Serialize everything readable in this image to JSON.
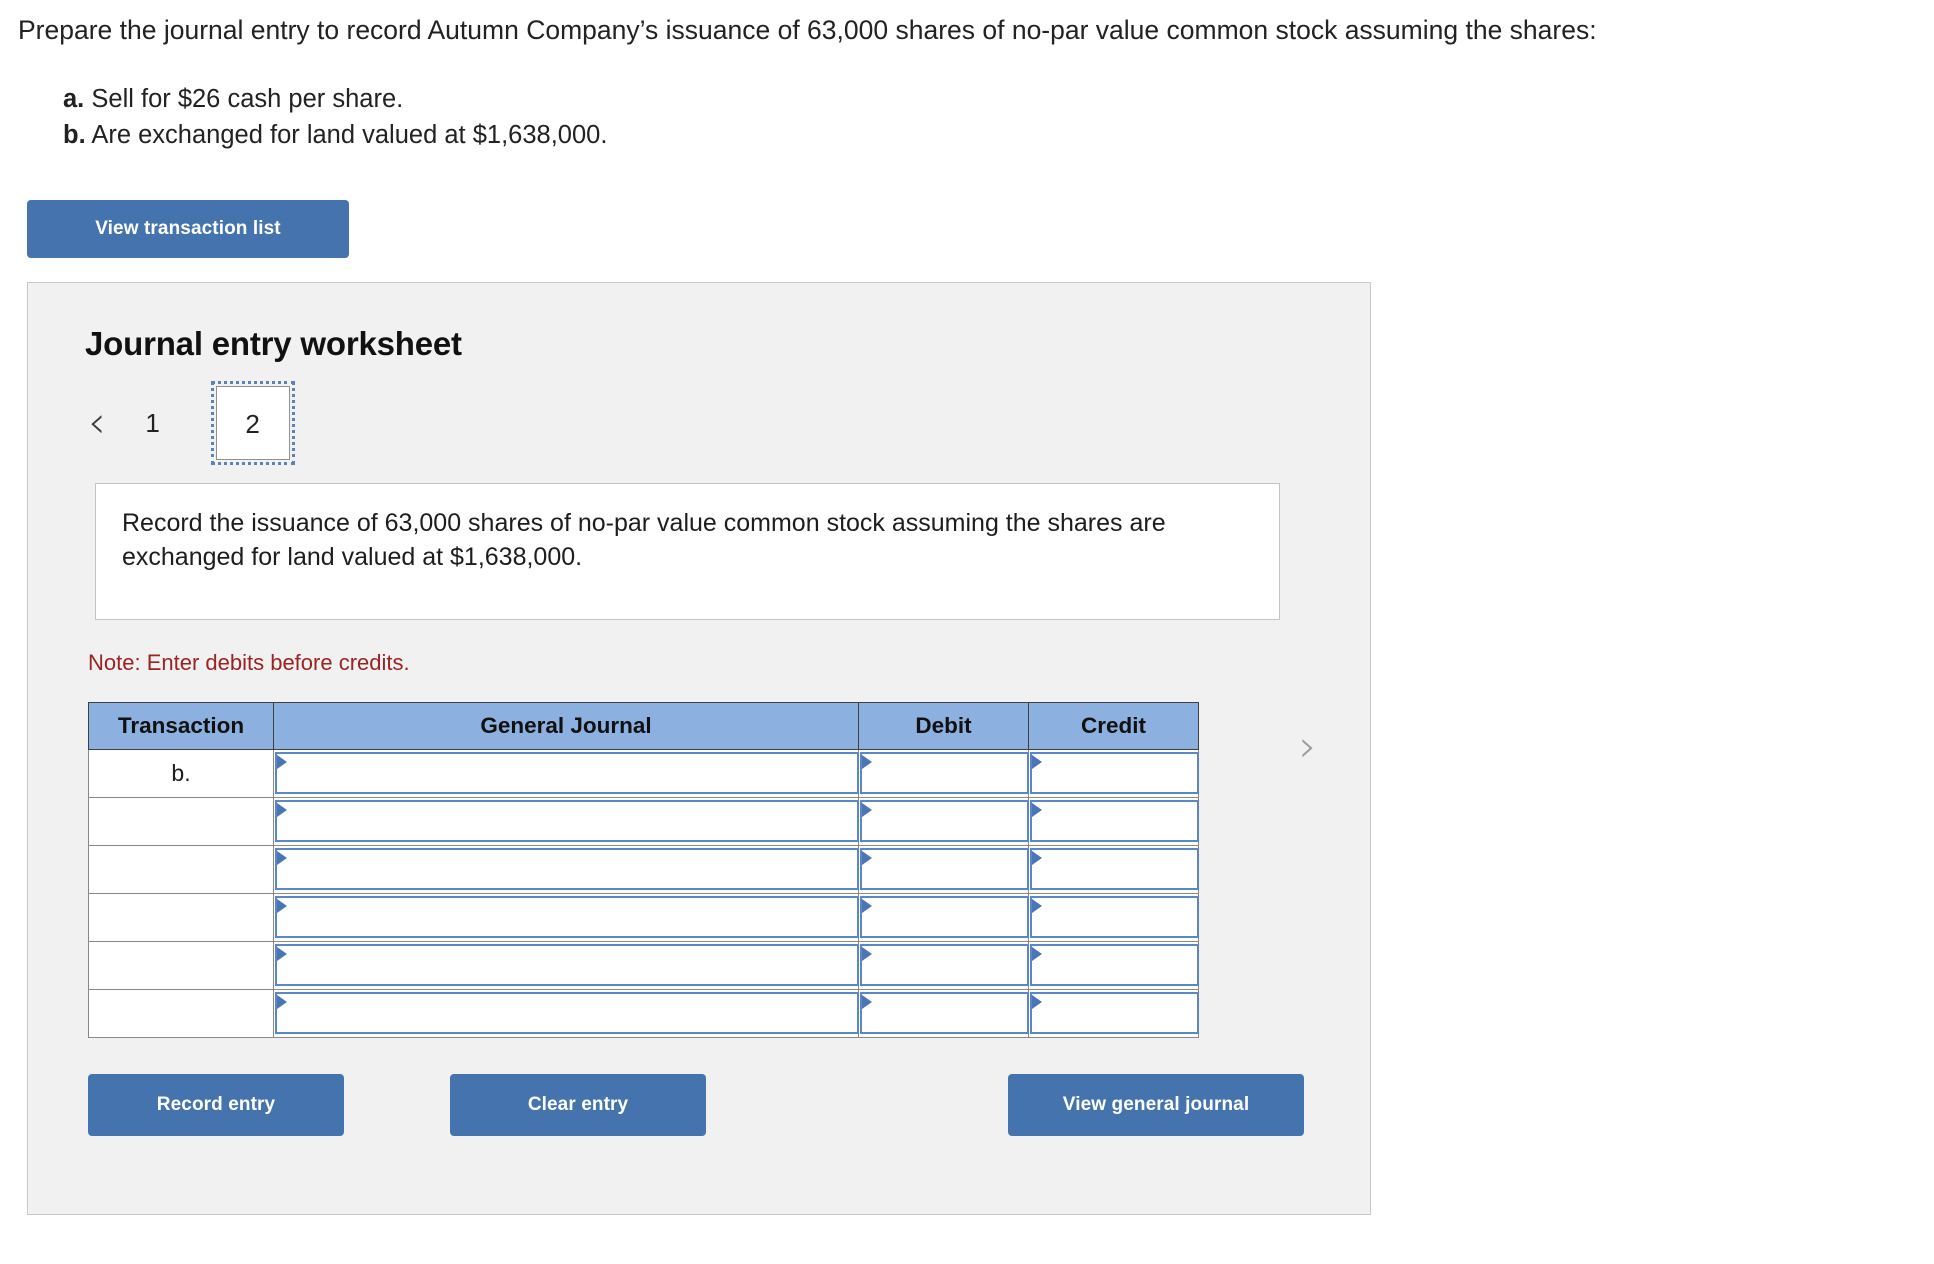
{
  "question": {
    "prompt": "Prepare the journal entry to record Autumn Company’s issuance of 63,000 shares of no-par value common stock assuming the shares:",
    "items": [
      {
        "label": "a.",
        "text": "Sell for $26 cash per share."
      },
      {
        "label": "b.",
        "text": "Are exchanged for land valued at $1,638,000."
      }
    ]
  },
  "toolbar": {
    "view_transaction_list_label": "View transaction list"
  },
  "worksheet": {
    "title": "Journal entry worksheet",
    "pager": {
      "prev_icon": "‹",
      "next_icon": "›",
      "pages": [
        "1",
        "2"
      ],
      "active_page": "2"
    },
    "instruction": "Record the issuance of 63,000 shares of no-par value common stock assuming the shares are exchanged for land valued at $1,638,000.",
    "note": "Note: Enter debits before credits.",
    "table": {
      "headers": [
        "Transaction",
        "General Journal",
        "Debit",
        "Credit"
      ],
      "rows": [
        {
          "transaction": "b.",
          "general_journal": "",
          "debit": "",
          "credit": ""
        },
        {
          "transaction": "",
          "general_journal": "",
          "debit": "",
          "credit": ""
        },
        {
          "transaction": "",
          "general_journal": "",
          "debit": "",
          "credit": ""
        },
        {
          "transaction": "",
          "general_journal": "",
          "debit": "",
          "credit": ""
        },
        {
          "transaction": "",
          "general_journal": "",
          "debit": "",
          "credit": ""
        },
        {
          "transaction": "",
          "general_journal": "",
          "debit": "",
          "credit": ""
        }
      ]
    },
    "actions": {
      "record_entry_label": "Record entry",
      "clear_entry_label": "Clear entry",
      "view_general_journal_label": "View general journal"
    }
  },
  "colors": {
    "button_blue": "#4473ad",
    "table_header_blue": "#8cb1e0",
    "cell_border_blue": "#5b87c4",
    "note_red": "#9b2423",
    "panel_bg": "#f1f1f1"
  }
}
